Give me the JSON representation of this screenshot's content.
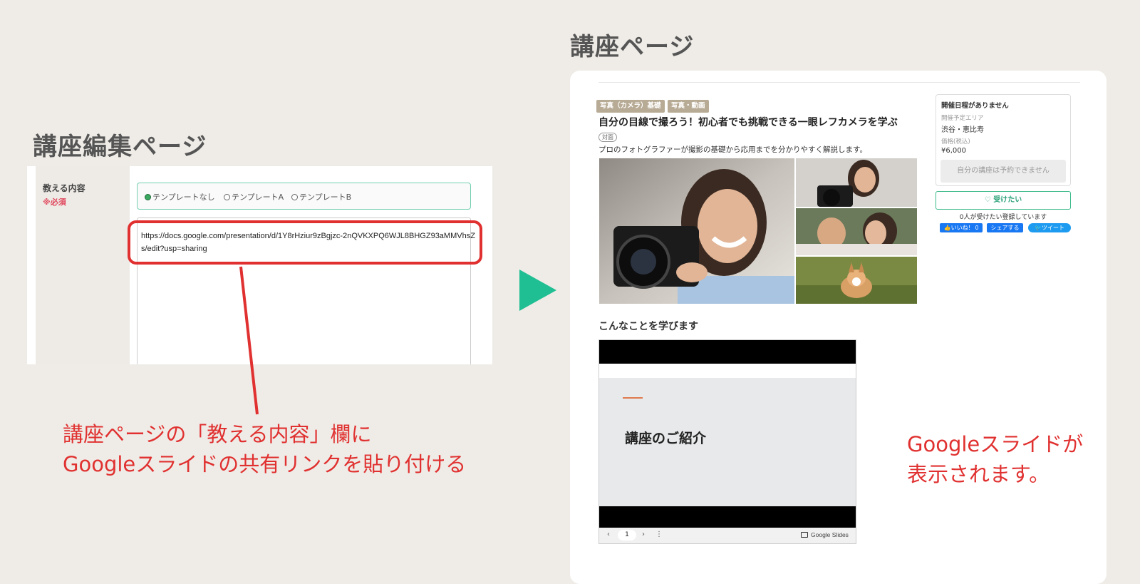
{
  "left": {
    "heading": "講座編集ページ",
    "field_label": "教える内容",
    "required_label": "※必須",
    "radio_options": [
      "テンプレートなし",
      "テンプレートA",
      "テンプレートB"
    ],
    "selected_option": "テンプレートなし",
    "url_value": "https://docs.google.com/presentation/d/1Y8rHziur9zBgjzc-2nQVKXPQ6WJL8BHGZ93aMMVhsZs/edit?usp=sharing",
    "note_line1": "講座ページの「教える内容」欄に",
    "note_line2": "Googleスライドの共有リンクを貼り付ける"
  },
  "right": {
    "heading": "講座ページ",
    "tags": [
      "写真（カメラ）基礎",
      "写真・動画"
    ],
    "course_title": "自分の目線で撮ろう！初心者でも挑戦できる一眼レフカメラを学ぶ",
    "cover_badge": "対面",
    "description": "プロのフォトグラファーが撮影の基礎から応用までを分かりやすく解説します。",
    "section_title": "こんなことを学びます",
    "slide_title": "講座のご紹介",
    "slides_page": "1",
    "slides_brand": "Google Slides",
    "sidebar": {
      "no_schedule": "開催日程がありません",
      "area_label": "開催予定エリア",
      "area_value": "渋谷・恵比寿",
      "price_label": "価格(税込)",
      "price_value": "¥6,000",
      "disabled_button": "自分の講座は予約できません",
      "want_button": "受けたい",
      "want_count": "0人が受けたい登録しています",
      "like_button": "いいね！ 0",
      "share_button": "シェアする",
      "tweet_button": "ツイート"
    },
    "note_line1": "Googleスライドが",
    "note_line2": "表示されます。"
  },
  "colors": {
    "accent_red": "#e03130",
    "arrow_green": "#1fbf93",
    "tag_beige": "#b8ab96",
    "want_green": "#3dba8a",
    "facebook_blue": "#1877f2",
    "twitter_blue": "#1d9bf0"
  },
  "icons": {
    "arrow": "play-triangle-icon",
    "heart": "heart-icon",
    "slides": "google-slides-icon"
  }
}
